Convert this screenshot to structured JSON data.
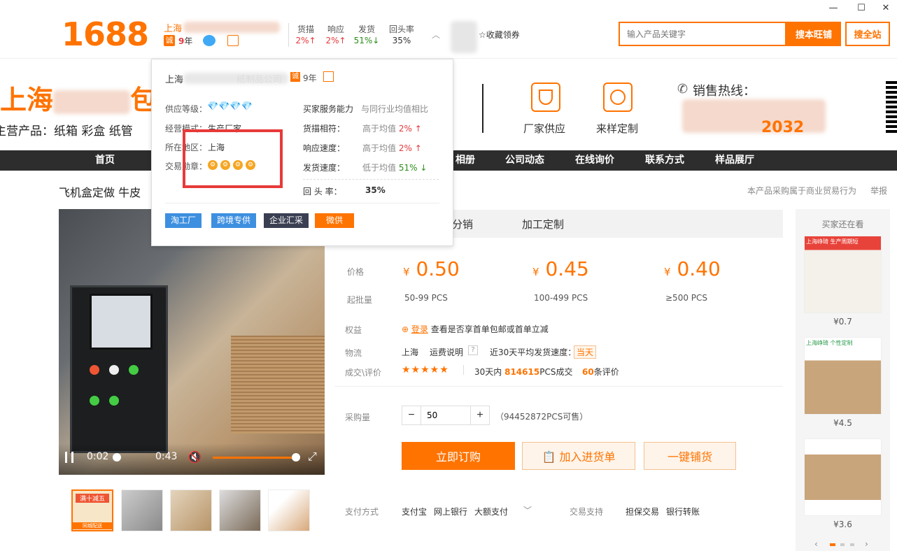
{
  "window_controls": {
    "minimize": "—",
    "maximize": "☐",
    "close": "✕"
  },
  "header": {
    "logo": "1688",
    "company_short": "上海",
    "cheng_badge": "诚",
    "years_num": "9",
    "years_unit": "年",
    "stats": [
      {
        "label": "货描",
        "value": "2%↑",
        "color": "red"
      },
      {
        "label": "响应",
        "value": "2%↑",
        "color": "red"
      },
      {
        "label": "发货",
        "value": "51%↓",
        "color": "green"
      },
      {
        "label": "回头率",
        "value": "35%",
        "color": ""
      }
    ],
    "favorite": "收藏领券",
    "search_placeholder": "输入产品关键字",
    "search_ww": "搜本旺铺",
    "search_all": "搜全站"
  },
  "banner": {
    "name_prefix": "上海",
    "name_suffix": "包",
    "main_products": "主营产品：纸箱 彩盒 纸管",
    "factory_supply": "厂家供应",
    "sample_custom": "来样定制",
    "hotline_label": "销售热线：",
    "phone_tail": "2032"
  },
  "nav": {
    "items": [
      "首页",
      "相册",
      "公司动态",
      "在线询价",
      "联系方式",
      "样品展厅"
    ]
  },
  "product": {
    "title": "飞机盒定做 牛皮",
    "purchase_note": "本产品采购属于商业贸易行为",
    "report": "举报",
    "video": {
      "current": "0:02",
      "duration": "0:43"
    },
    "tabs": [
      "分销",
      "加工定制"
    ],
    "price_label": "价格",
    "moq_label": "起批量",
    "currency": "¥",
    "prices": [
      {
        "price": "0.50",
        "qty": "50-99 PCS"
      },
      {
        "price": "0.45",
        "qty": "100-499 PCS"
      },
      {
        "price": "0.40",
        "qty": "≥500 PCS"
      }
    ],
    "rights_label": "权益",
    "rights_login": "登录",
    "rights_text": "查看是否享首单包邮或首单立减",
    "logistics_label": "物流",
    "logistics_city": "上海",
    "logistics_fee": "运费说明",
    "logistics_speed": "近30天平均发货速度：",
    "logistics_today": "当天",
    "reviews_label": "成交\\评价",
    "stars": "★★★★★",
    "sold_prefix": "30天内",
    "sold_num": "814615",
    "sold_suffix": "PCS成交",
    "review_num": "60",
    "review_suffix": "条评价",
    "qty_label": "采购量",
    "qty_value": "50",
    "stock": "（94452872PCS可售）",
    "buy": "立即订购",
    "cart": "加入进货单",
    "dist": "一键铺货",
    "pay_label": "支付方式",
    "pay_methods": [
      "支付宝",
      "网上银行",
      "大额支付"
    ],
    "trade_label": "交易支持",
    "trade_methods": [
      "担保交易",
      "银行转账"
    ]
  },
  "thumb_promo": {
    "line1": "满十减五",
    "line2": "同城配送"
  },
  "side": {
    "title": "买家还在看",
    "items": [
      {
        "price": "¥0.7",
        "tag": "生产周期短",
        "brand": "上海峥琦"
      },
      {
        "price": "¥4.5",
        "tag": "个性定制",
        "brand": "上海峥琦"
      },
      {
        "price": "¥3.6",
        "tag": "",
        "brand": ""
      }
    ]
  },
  "popup": {
    "company": "上海",
    "company_suffix": "纸制品公司",
    "cheng": "诚",
    "years": "9年",
    "supply_level_label": "供应等级：",
    "supply_level": "💎💎💎💎",
    "biz_mode_label": "经营模式：",
    "biz_mode": "生产厂家",
    "region_label": "所在地区：",
    "region": "上海",
    "medal_label": "交易勋章：",
    "buyer_service": "买家服务能力",
    "compare": "与同行业均值相比",
    "metrics": [
      {
        "label": "货描相符：",
        "cmp": "高于均值",
        "val": "2%",
        "arrow": "↑",
        "color": "red"
      },
      {
        "label": "响应速度：",
        "cmp": "高于均值",
        "val": "2%",
        "arrow": "↑",
        "color": "red"
      },
      {
        "label": "发货速度：",
        "cmp": "低于均值",
        "val": "51%",
        "arrow": "↓",
        "color": "green"
      }
    ],
    "return_label": "回 头 率：",
    "return_val": "35%",
    "tags": [
      {
        "label": "淘工厂",
        "color": "#3d8fe0"
      },
      {
        "label": "跨境专供",
        "color": "#3d8fe0"
      },
      {
        "label": "企业汇采",
        "color": "#3a3f52"
      },
      {
        "label": "微供",
        "color": "#ff7300"
      }
    ]
  }
}
